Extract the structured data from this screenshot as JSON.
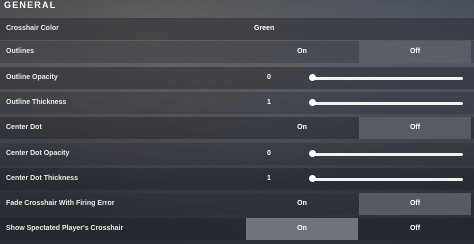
{
  "section": {
    "title": "GENERAL"
  },
  "rows": [
    {
      "label": "Crosshair Color",
      "value": "Green"
    },
    {
      "label": "Outlines",
      "on": "On",
      "off": "Off",
      "selected": "off"
    },
    {
      "label": "Outline Opacity",
      "value": "0",
      "slider_level": 0
    },
    {
      "label": "Outline Thickness",
      "value": "1",
      "slider_level": 0
    },
    {
      "label": "Center Dot",
      "on": "On",
      "off": "Off",
      "selected": "off"
    },
    {
      "label": "Center Dot Opacity",
      "value": "0",
      "slider_level": 0
    },
    {
      "label": "Center Dot Thickness",
      "value": "1",
      "slider_level": 0
    },
    {
      "label": "Fade Crosshair With Firing Error",
      "on": "On",
      "off": "Off",
      "selected": "off"
    },
    {
      "label": "Show Spectated Player's Crosshair",
      "on": "On",
      "off": "Off",
      "selected": "on"
    }
  ]
}
